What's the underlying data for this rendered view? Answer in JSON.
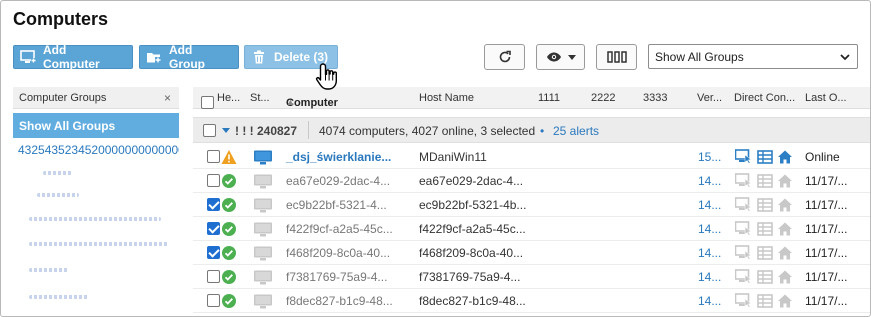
{
  "page": {
    "title": "Computers"
  },
  "toolbar": {
    "add_computer": "Add Computer",
    "add_group": "Add Group",
    "delete": "Delete (3)",
    "group_filter": "Show All Groups"
  },
  "sidebar": {
    "header": "Computer Groups",
    "close_glyph": "×",
    "selected": "Show All Groups",
    "group_id": "4325435234520000000000000"
  },
  "grid": {
    "columns": [
      "He...",
      "St...",
      "Computer",
      "Host Name",
      "1111",
      "2222",
      "3333",
      "Ver...",
      "Direct Con...",
      "Last O..."
    ],
    "sort_glyph": "▲",
    "summary": {
      "group_id": "! ! ! 240827",
      "text": "4074 computers, 4027 online, 3 selected",
      "bullet": "•",
      "alerts": "25 alerts"
    },
    "rows": [
      {
        "checked": false,
        "status": "warning",
        "monitor": "active",
        "computer": "_dsj_świerklanie...",
        "host": "MDaniWin11",
        "version": "15...",
        "direct": "active",
        "last_online": "Online"
      },
      {
        "checked": false,
        "status": "ok",
        "monitor": "inactive",
        "computer": "ea67e029-2dac-4...",
        "host": "ea67e029-2dac-4...",
        "version": "14...",
        "direct": "inactive",
        "last_online": "11/17/..."
      },
      {
        "checked": true,
        "status": "ok",
        "monitor": "inactive",
        "computer": "ec9b22bf-5321-4...",
        "host": "ec9b22bf-5321-4b...",
        "version": "14...",
        "direct": "inactive",
        "last_online": "11/17/..."
      },
      {
        "checked": true,
        "status": "ok",
        "monitor": "inactive",
        "computer": "f422f9cf-a2a5-45c...",
        "host": "f422f9cf-a2a5-45c...",
        "version": "14...",
        "direct": "inactive",
        "last_online": "11/17/..."
      },
      {
        "checked": true,
        "status": "ok",
        "monitor": "inactive",
        "computer": "f468f209-8c0a-40...",
        "host": "f468f209-8c0a-40...",
        "version": "14...",
        "direct": "inactive",
        "last_online": "11/17/..."
      },
      {
        "checked": false,
        "status": "ok",
        "monitor": "inactive",
        "computer": "f7381769-75a9-4...",
        "host": "f7381769-75a9-4...",
        "version": "14...",
        "direct": "inactive",
        "last_online": "11/17/..."
      },
      {
        "checked": false,
        "status": "ok",
        "monitor": "inactive",
        "computer": "f8dec827-b1c9-48...",
        "host": "f8dec827-b1c9-48...",
        "version": "14...",
        "direct": "inactive",
        "last_online": "11/17/..."
      }
    ]
  },
  "colors": {
    "accent": "#5ba4d6",
    "link": "#2a78bd",
    "ok": "#4caf50",
    "warning": "#f0a020"
  }
}
